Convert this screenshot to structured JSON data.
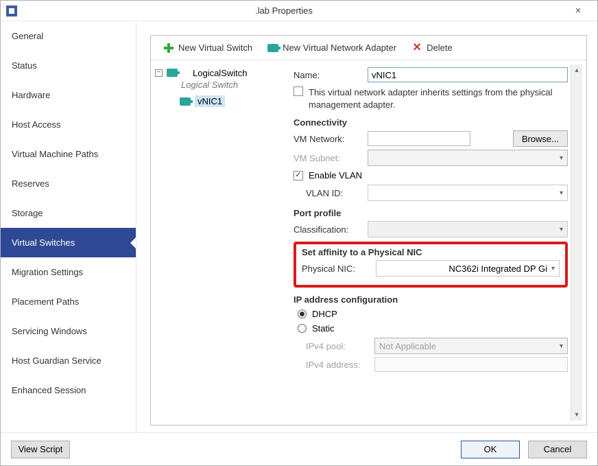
{
  "window": {
    "title": ".lab Properties"
  },
  "sidebar": {
    "items": [
      {
        "label": "General",
        "selected": false
      },
      {
        "label": "Status",
        "selected": false
      },
      {
        "label": "Hardware",
        "selected": false
      },
      {
        "label": "Host Access",
        "selected": false
      },
      {
        "label": "Virtual Machine Paths",
        "selected": false
      },
      {
        "label": "Reserves",
        "selected": false
      },
      {
        "label": "Storage",
        "selected": false
      },
      {
        "label": "Virtual Switches",
        "selected": true
      },
      {
        "label": "Migration Settings",
        "selected": false
      },
      {
        "label": "Placement Paths",
        "selected": false
      },
      {
        "label": "Servicing Windows",
        "selected": false
      },
      {
        "label": "Host Guardian Service",
        "selected": false
      },
      {
        "label": "Enhanced Session",
        "selected": false
      }
    ]
  },
  "toolbar": {
    "new_switch": "New Virtual Switch",
    "new_adapter": "New Virtual Network Adapter",
    "delete": "Delete"
  },
  "tree": {
    "root_label": "LogicalSwitch",
    "root_caption": "Logical Switch",
    "child_label": "vNIC1"
  },
  "form": {
    "name_label": "Name:",
    "name_value": "vNIC1",
    "inherit_text": "This virtual network adapter inherits settings from the physical management adapter.",
    "connectivity_heading": "Connectivity",
    "vm_network_label": "VM Network:",
    "vm_network_value": "",
    "browse_label": "Browse...",
    "vm_subnet_label": "VM Subnet:",
    "vm_subnet_value": "",
    "enable_vlan_label": "Enable VLAN",
    "vlan_id_label": "VLAN ID:",
    "vlan_id_value": "",
    "port_profile_heading": "Port profile",
    "classification_label": "Classification:",
    "classification_value": "",
    "affinity_heading": "Set affinity to a Physical NIC",
    "physical_nic_label": "Physical NIC:",
    "physical_nic_value": "NC362i Integrated DP Gi",
    "ip_config_heading": "IP address configuration",
    "dhcp_label": "DHCP",
    "static_label": "Static",
    "ipv4_pool_label": "IPv4 pool:",
    "ipv4_pool_value": "Not Applicable",
    "ipv4_address_label": "IPv4 address:",
    "ipv4_address_value": ""
  },
  "footer": {
    "view_script": "View Script",
    "ok": "OK",
    "cancel": "Cancel"
  }
}
